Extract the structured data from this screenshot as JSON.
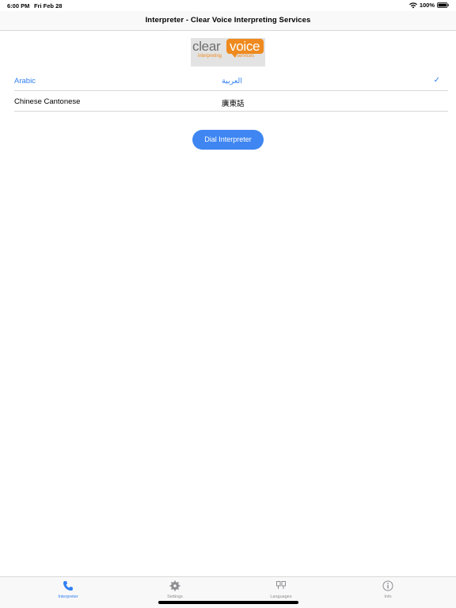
{
  "status_bar": {
    "time": "6:00 PM",
    "date": "Fri Feb 28",
    "battery": "100%"
  },
  "nav": {
    "title": "Interpreter - Clear Voice Interpreting Services"
  },
  "logo": {
    "word1": "clear",
    "word2": "voice",
    "sub1": "interpreting",
    "sub2": "services",
    "accent_color": "#ee8a1f"
  },
  "languages": [
    {
      "name": "Arabic",
      "native": "العربية",
      "selected": true
    },
    {
      "name": "Chinese Cantonese",
      "native": "廣東話",
      "selected": false
    }
  ],
  "check_mark": "✓",
  "dial_button": {
    "label": "Dial Interpreter",
    "color": "#3f86f2"
  },
  "tabs": [
    {
      "label": "Interpreter",
      "icon": "phone-icon",
      "active": true
    },
    {
      "label": "Settings",
      "icon": "gear-icon",
      "active": false
    },
    {
      "label": "Languages",
      "icon": "quote-icon",
      "active": false
    },
    {
      "label": "Info",
      "icon": "info-icon",
      "active": false
    }
  ],
  "colors": {
    "accent": "#2f7ff2",
    "inactive_tab": "#8e8e93"
  }
}
